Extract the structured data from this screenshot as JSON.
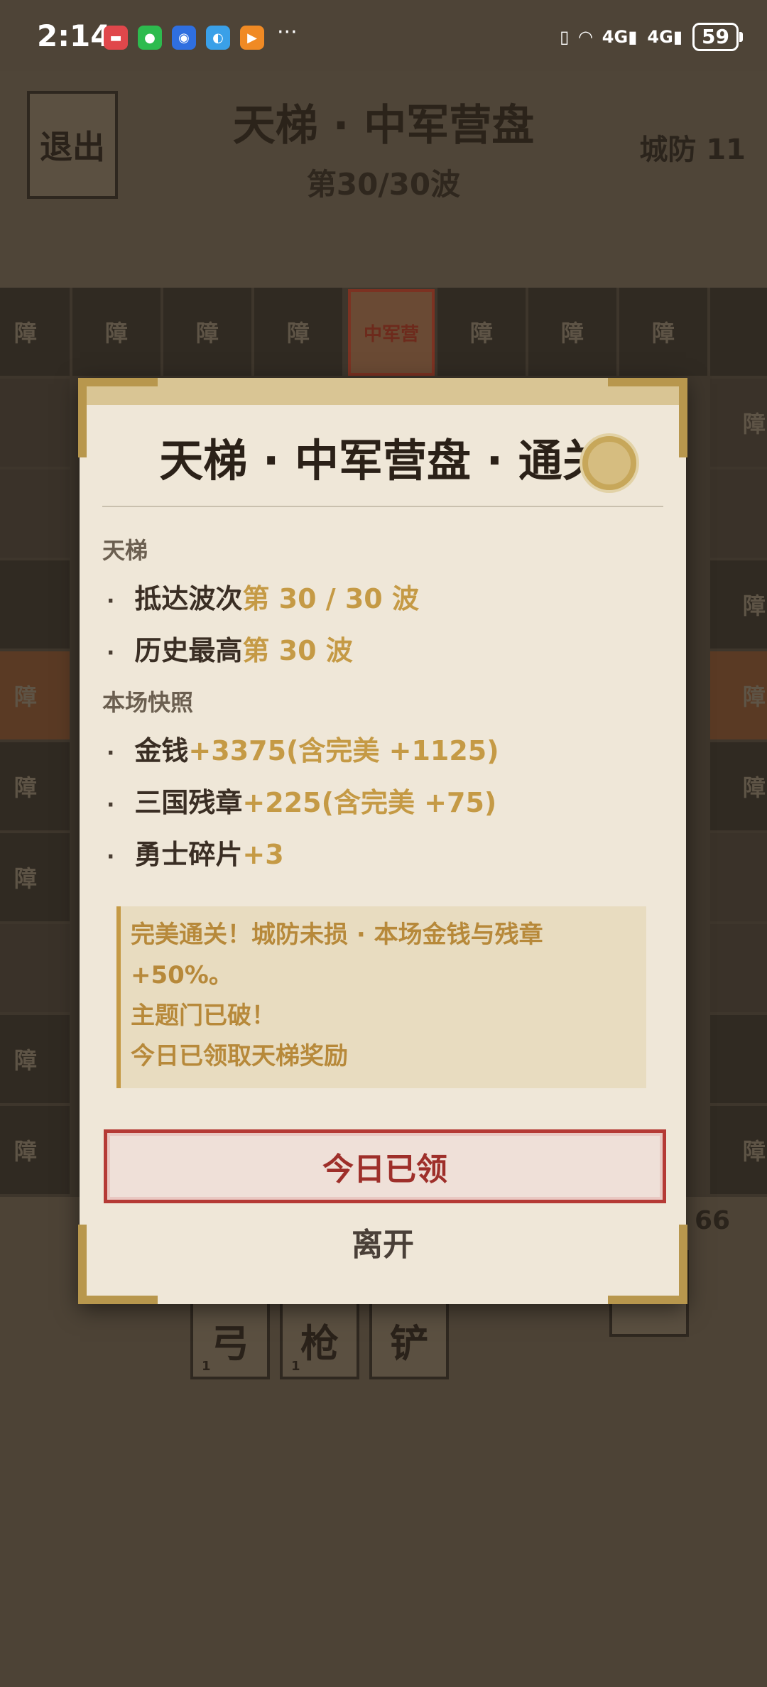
{
  "status_bar": {
    "time": "2:14",
    "more": "···",
    "battery": "59",
    "signal_labels": [
      "4G",
      "4G"
    ]
  },
  "game": {
    "exit_label": "退出",
    "title": "天梯 · 中军营盘",
    "wave": "第30/30波",
    "city_defense": "城防 11",
    "obstacle_label": "障",
    "hq_label": "中军营",
    "deck_items": [
      {
        "label": "弓",
        "count": "1"
      },
      {
        "label": "枪",
        "count": "1"
      },
      {
        "label": "铲",
        "count": ""
      }
    ],
    "side_value": "66"
  },
  "modal": {
    "title": "天梯 · 中军营盘 · 通关",
    "section_ladder": "天梯",
    "wave_reached_key": "抵达波次",
    "wave_reached_val": "第 30 / 30 波",
    "best_key": "历史最高",
    "best_val": "第 30 波",
    "section_snapshot": "本场快照",
    "gold_key": "金钱",
    "gold_val": "+3375(含完美 +1125)",
    "badge_key": "三国残章",
    "badge_val": "+225(含完美 +75)",
    "shard_key": "勇士碎片",
    "shard_val": "+3",
    "note_lines": [
      "完美通关！城防未损 · 本场金钱与残章",
      "+50%。",
      "主题门已破！",
      "今日已领取天梯奖励"
    ],
    "claim_button": "今日已领",
    "leave_button": "离开",
    "bullet": "·"
  }
}
